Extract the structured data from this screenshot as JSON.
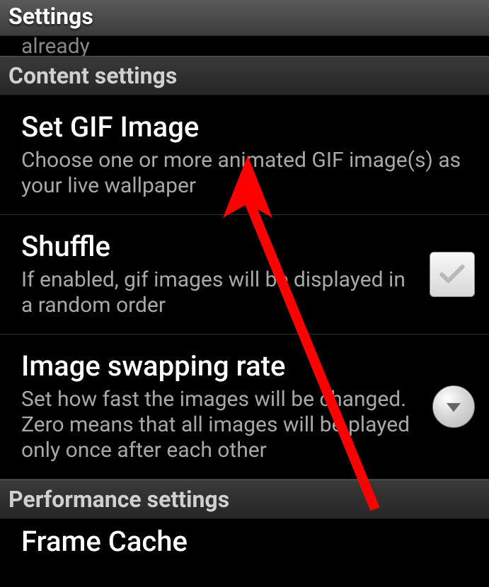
{
  "header": {
    "title": "Settings"
  },
  "truncated_top": "already",
  "sections": {
    "content": {
      "header": "Content settings",
      "items": {
        "set_gif": {
          "title": "Set GIF Image",
          "summary": "Choose one or more animated GIF image(s) as your live wallpaper"
        },
        "shuffle": {
          "title": "Shuffle",
          "summary": "If enabled, gif images will be displayed in a random order"
        },
        "swap_rate": {
          "title": "Image swapping rate",
          "summary": "Set how fast the images will be changed. Zero means that all images will be played only once after each other"
        }
      }
    },
    "performance": {
      "header": "Performance settings",
      "items": {
        "frame_cache": {
          "title": "Frame Cache"
        }
      }
    }
  }
}
